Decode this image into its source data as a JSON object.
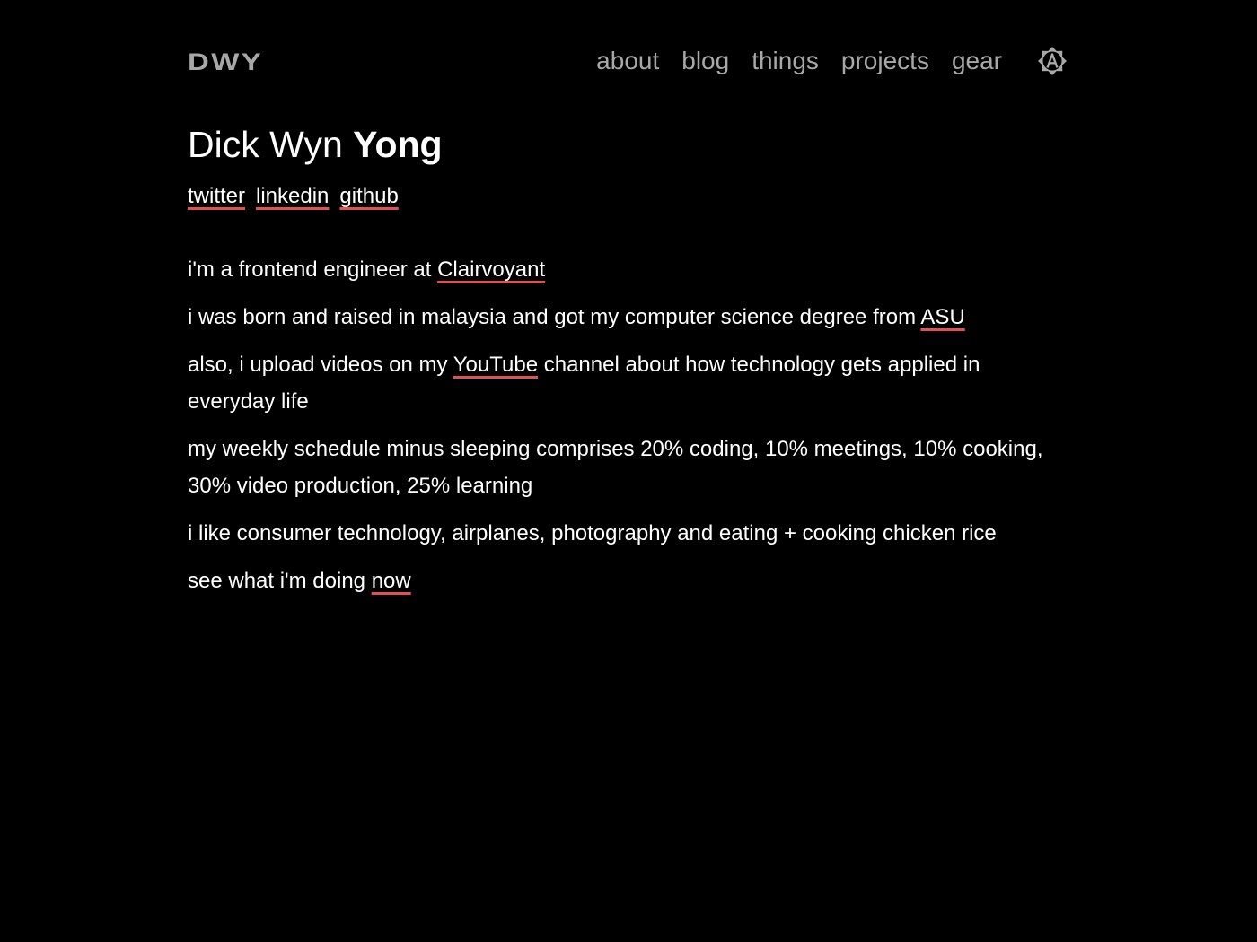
{
  "header": {
    "logo": "DWY",
    "nav": [
      "about",
      "blog",
      "things",
      "projects",
      "gear"
    ],
    "theme_icon": "auto-brightness-icon"
  },
  "profile": {
    "first_names": "Dick Wyn ",
    "last_name": "Yong",
    "social": [
      "twitter",
      "linkedin",
      "github"
    ]
  },
  "bio": {
    "line1": {
      "text": "i'm a frontend engineer at ",
      "link": "Clairvoyant"
    },
    "line2": {
      "text": "i was born and raised in malaysia and got my computer science degree from ",
      "link": "ASU"
    },
    "line3": {
      "before": "also, i upload videos on my ",
      "link": "YouTube",
      "after": " channel about how technology gets applied in everyday life"
    },
    "line4": "my weekly schedule minus sleeping comprises 20% coding, 10% meetings, 10% cooking, 30% video production, 25% learning",
    "line5": "i like consumer technology, airplanes, photography and eating + cooking chicken rice",
    "line6": {
      "text": "see what i'm doing ",
      "link": "now"
    }
  },
  "colors": {
    "background": "#000000",
    "text": "#ffffff",
    "muted": "#a8a8a8",
    "underline_accent": "#e05252"
  }
}
